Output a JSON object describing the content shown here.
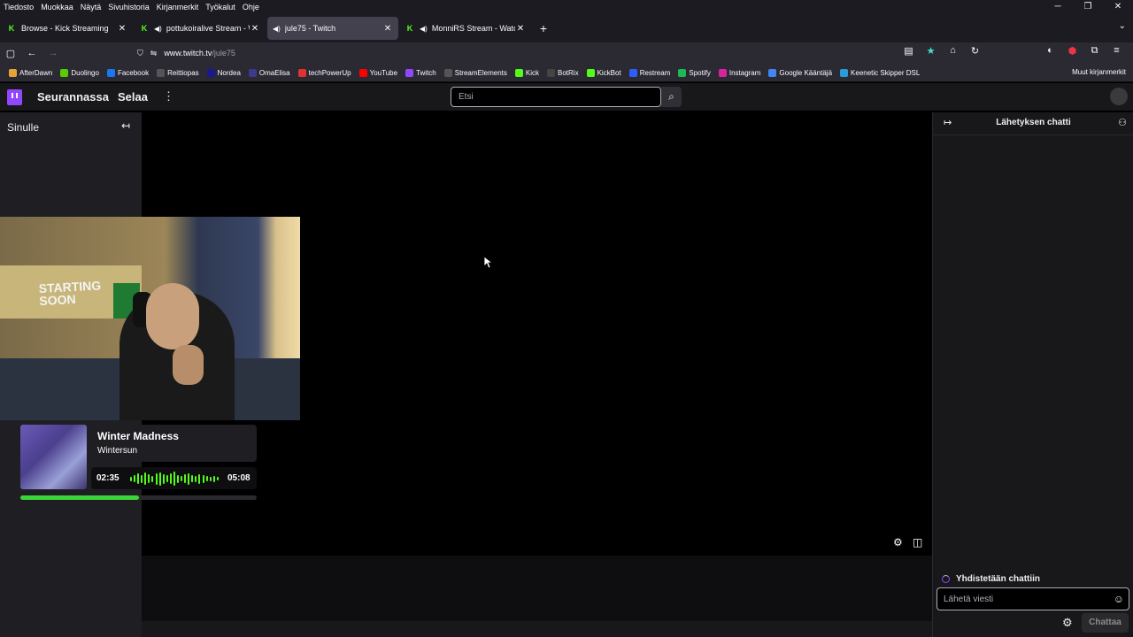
{
  "menu": [
    "Tiedosto",
    "Muokkaa",
    "Näytä",
    "Sivuhistoria",
    "Kirjanmerkit",
    "Työkalut",
    "Ohje"
  ],
  "tabs": [
    {
      "label": "Browse - Kick Streaming",
      "icon": "kick-icon"
    },
    {
      "label": "pottukoiralive Stream - Wa",
      "icon": "kick-icon"
    },
    {
      "label": "jule75 - Twitch",
      "icon": "speaker-icon"
    },
    {
      "label": "MonniRS Stream - Watch Li",
      "icon": "kick-icon"
    }
  ],
  "url": {
    "host": "www.twitch.tv",
    "path": "/jule75"
  },
  "bookmarks": [
    "AfterDawn",
    "Duolingo",
    "Facebook",
    "Reittiopas",
    "Nordea",
    "OmaElisa",
    "techPowerUp",
    "YouTube",
    "Twitch",
    "StreamElements",
    "Kick",
    "BotRix",
    "KickBot",
    "Restream",
    "Spotify",
    "Instagram",
    "Google Kääntäjä",
    "Keenetic Skipper DSL"
  ],
  "bookmark_colors": [
    "#e8a23a",
    "#58cc02",
    "#1877f2",
    "#555",
    "#1a1a8f",
    "#3b3b8a",
    "#d33",
    "#f00",
    "#9147ff",
    "#555",
    "#53fc18",
    "#444",
    "#53fc18",
    "#2d5cff",
    "#1db954",
    "#d6249f",
    "#4285f4",
    "#2a9bd8"
  ],
  "bookmarks_other": "Muut kirjanmerkit",
  "twitch": {
    "following": "Seurannassa",
    "browse": "Selaa",
    "search_placeholder": "Etsi",
    "sidebar_title": "Sinulle"
  },
  "overlay": {
    "poster_text": "STARTING SOON",
    "song_title": "Winter Madness",
    "artist": "Wintersun",
    "time_current": "02:35",
    "time_total": "05:08",
    "progress": 0.5
  },
  "chat": {
    "title": "Lähetyksen chatti",
    "connecting": "Yhdistetään chattiin",
    "input_placeholder": "Lähetä viesti",
    "send_label": "Chattaa"
  },
  "colors": {
    "accent": "#9147ff",
    "kick_green": "#53fc18"
  }
}
